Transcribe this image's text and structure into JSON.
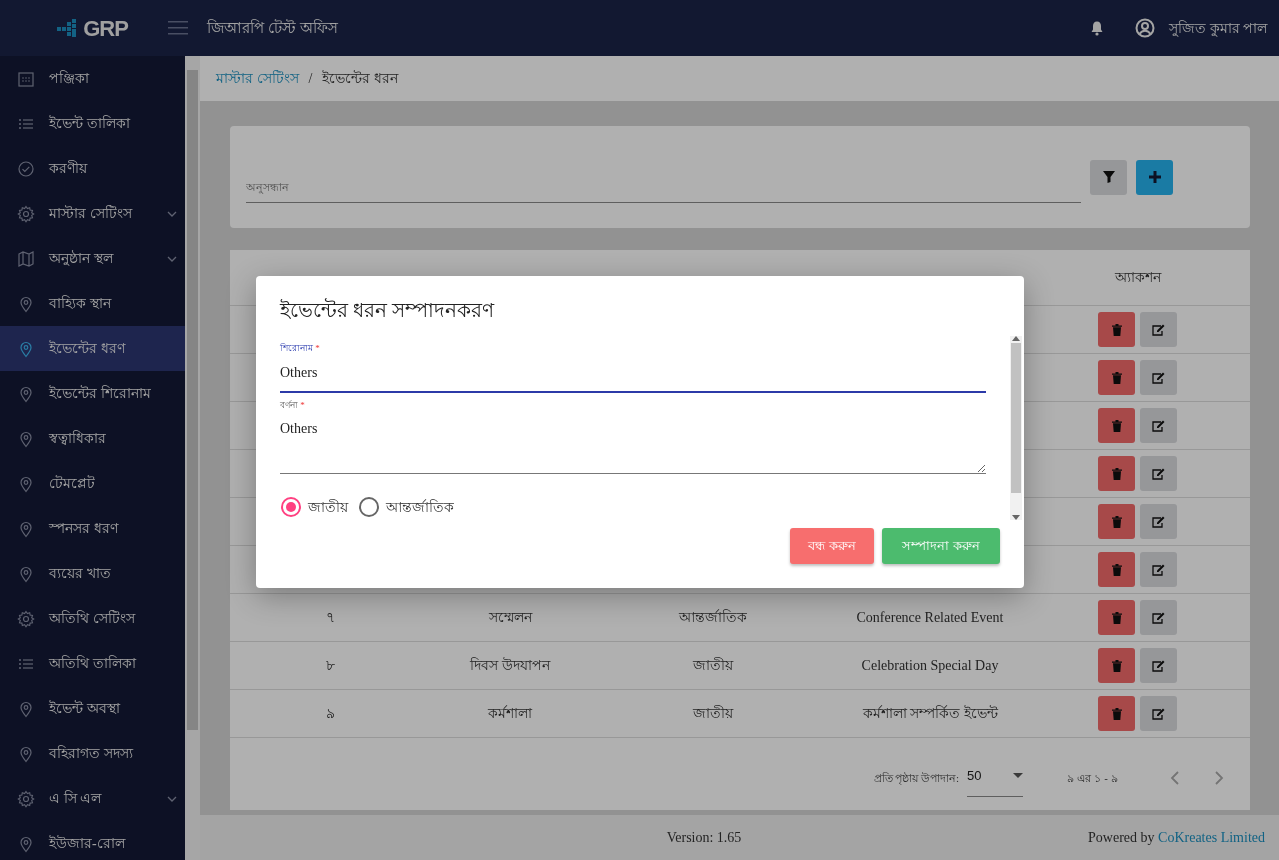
{
  "navbar": {
    "logo": "GRP",
    "office": "জিআরপি টেস্ট অফিস",
    "user": "সুজিত কুমার পাল"
  },
  "sidebar": {
    "items": [
      {
        "label": "পঞ্জিকা",
        "kind": "calendar",
        "expandable": false,
        "selected": false
      },
      {
        "label": "ইভেন্ট তালিকা",
        "kind": "list",
        "expandable": false,
        "selected": false
      },
      {
        "label": "করণীয়",
        "kind": "check",
        "expandable": false,
        "selected": false
      },
      {
        "label": "মাস্টার সেটিংস",
        "kind": "gear",
        "expandable": true,
        "selected": false
      },
      {
        "label": "অনুষ্ঠান স্থল",
        "kind": "map",
        "expandable": true,
        "selected": false
      },
      {
        "label": "বাহ্যিক স্থান",
        "kind": "pin",
        "expandable": false,
        "selected": false
      },
      {
        "label": "ইভেন্টের ধরণ",
        "kind": "pin",
        "expandable": false,
        "selected": true
      },
      {
        "label": "ইভেন্টের শিরোনাম",
        "kind": "pin",
        "expandable": false,
        "selected": false
      },
      {
        "label": "স্বত্বাধিকার",
        "kind": "pin",
        "expandable": false,
        "selected": false
      },
      {
        "label": "টেমপ্লেট",
        "kind": "pin",
        "expandable": false,
        "selected": false
      },
      {
        "label": "স্পনসর ধরণ",
        "kind": "pin",
        "expandable": false,
        "selected": false
      },
      {
        "label": "ব্যয়ের খাত",
        "kind": "pin",
        "expandable": false,
        "selected": false
      },
      {
        "label": "অতিথি সেটিংস",
        "kind": "gear",
        "expandable": false,
        "selected": false
      },
      {
        "label": "অতিথি তালিকা",
        "kind": "list",
        "expandable": false,
        "selected": false
      },
      {
        "label": "ইভেন্ট অবস্থা",
        "kind": "pin",
        "expandable": false,
        "selected": false
      },
      {
        "label": "বহিরাগত সদস্য",
        "kind": "pin",
        "expandable": false,
        "selected": false
      },
      {
        "label": "এ সি এল",
        "kind": "gear",
        "expandable": true,
        "selected": false
      },
      {
        "label": "ইউজার-রোল",
        "kind": "pin",
        "expandable": false,
        "selected": false
      }
    ]
  },
  "breadcrumb": [
    {
      "label": "মাস্টার সেটিংস",
      "kind": "link"
    },
    {
      "label": "/",
      "kind": "separator"
    },
    {
      "label": "ইভেন্টের ধরন",
      "kind": "current"
    }
  ],
  "search": {
    "placeholder": "অনুসন্ধান"
  },
  "table": {
    "columns": [
      {
        "kind": "covered"
      },
      {
        "kind": "covered"
      },
      {
        "kind": "covered"
      },
      {
        "kind": "covered"
      },
      {
        "kind": "shown",
        "label": "অ্যাকশন"
      }
    ],
    "rows": [
      {
        "kind": "covered"
      },
      {
        "kind": "covered"
      },
      {
        "kind": "covered"
      },
      {
        "kind": "covered"
      },
      {
        "kind": "covered"
      },
      {
        "kind": "covered"
      },
      {
        "kind": "full",
        "cells": [
          "৭",
          "সম্মেলন",
          "আন্তর্জাতিক",
          "Conference Related Event"
        ]
      },
      {
        "kind": "full",
        "cells": [
          "৮",
          "দিবস উদযাপন",
          "জাতীয়",
          "Celebration Special Day"
        ]
      },
      {
        "kind": "full",
        "cells": [
          "৯",
          "কর্মশালা",
          "জাতীয়",
          "কর্মশালা সম্পর্কিত ইভেন্ট"
        ]
      }
    ]
  },
  "pagination": {
    "label": "প্রতি পৃষ্ঠায় উপাদান:",
    "page_size": "50",
    "range": "৯ এর ১ - ৯",
    "prev_disabled": true,
    "next_disabled": true
  },
  "footer": {
    "version": "Version: 1.65",
    "powered_by": "Powered by",
    "company": "CoKreates Limited"
  },
  "modal": {
    "title": "ইভেন্টের ধরন সম্পাদনকরণ",
    "fields": [
      {
        "kind": "input",
        "label": "শিরোনাম",
        "required": "*",
        "value": "Others",
        "focused": true
      },
      {
        "kind": "textarea",
        "label": "বর্ণনা",
        "required": "*",
        "value": "Others",
        "focused": false
      }
    ],
    "radios": [
      {
        "label": "জাতীয়",
        "selected": true
      },
      {
        "label": "আন্তর্জাতিক",
        "selected": false
      }
    ],
    "buttons": [
      {
        "label": "বন্ধ করুন",
        "kind": "cancel"
      },
      {
        "label": "সম্পাদনা করুন",
        "kind": "submit"
      }
    ]
  }
}
